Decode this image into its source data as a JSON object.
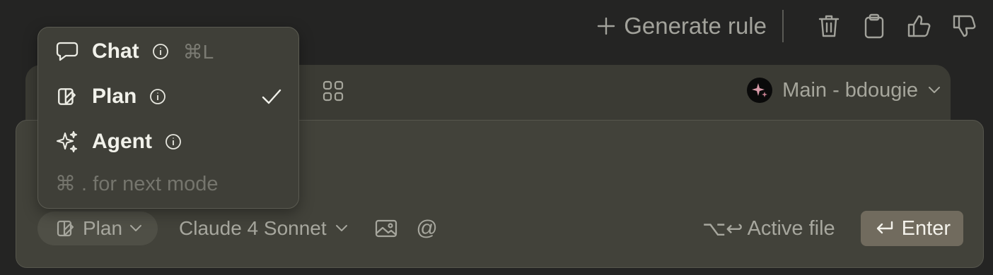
{
  "toolbar": {
    "generate_rule_label": "Generate rule",
    "icons": [
      "plus-icon",
      "trash-icon",
      "clipboard-icon",
      "thumbs-up-icon",
      "thumbs-down-icon"
    ]
  },
  "context_bar": {
    "branch_label": "Main - bdougie"
  },
  "composer": {
    "mode_label": "Plan",
    "model_label": "Claude 4 Sonnet",
    "at_symbol": "@",
    "active_file_shortcut": "⌥↩",
    "active_file_label": "Active file",
    "enter_label": "Enter"
  },
  "mode_menu": {
    "items": [
      {
        "label": "Chat",
        "shortcut": "⌘L",
        "selected": false,
        "icon": "chat-bubble-icon"
      },
      {
        "label": "Plan",
        "shortcut": "",
        "selected": true,
        "icon": "plan-icon"
      },
      {
        "label": "Agent",
        "shortcut": "",
        "selected": false,
        "icon": "sparkle-icon"
      }
    ],
    "hint": "⌘ . for next mode"
  },
  "colors": {
    "background": "#242423",
    "panel": "#42423a",
    "menu": "#3f3f38",
    "enter_button": "#716b5e",
    "text_primary": "#f1f1ea",
    "text_muted": "#a7a79e"
  }
}
